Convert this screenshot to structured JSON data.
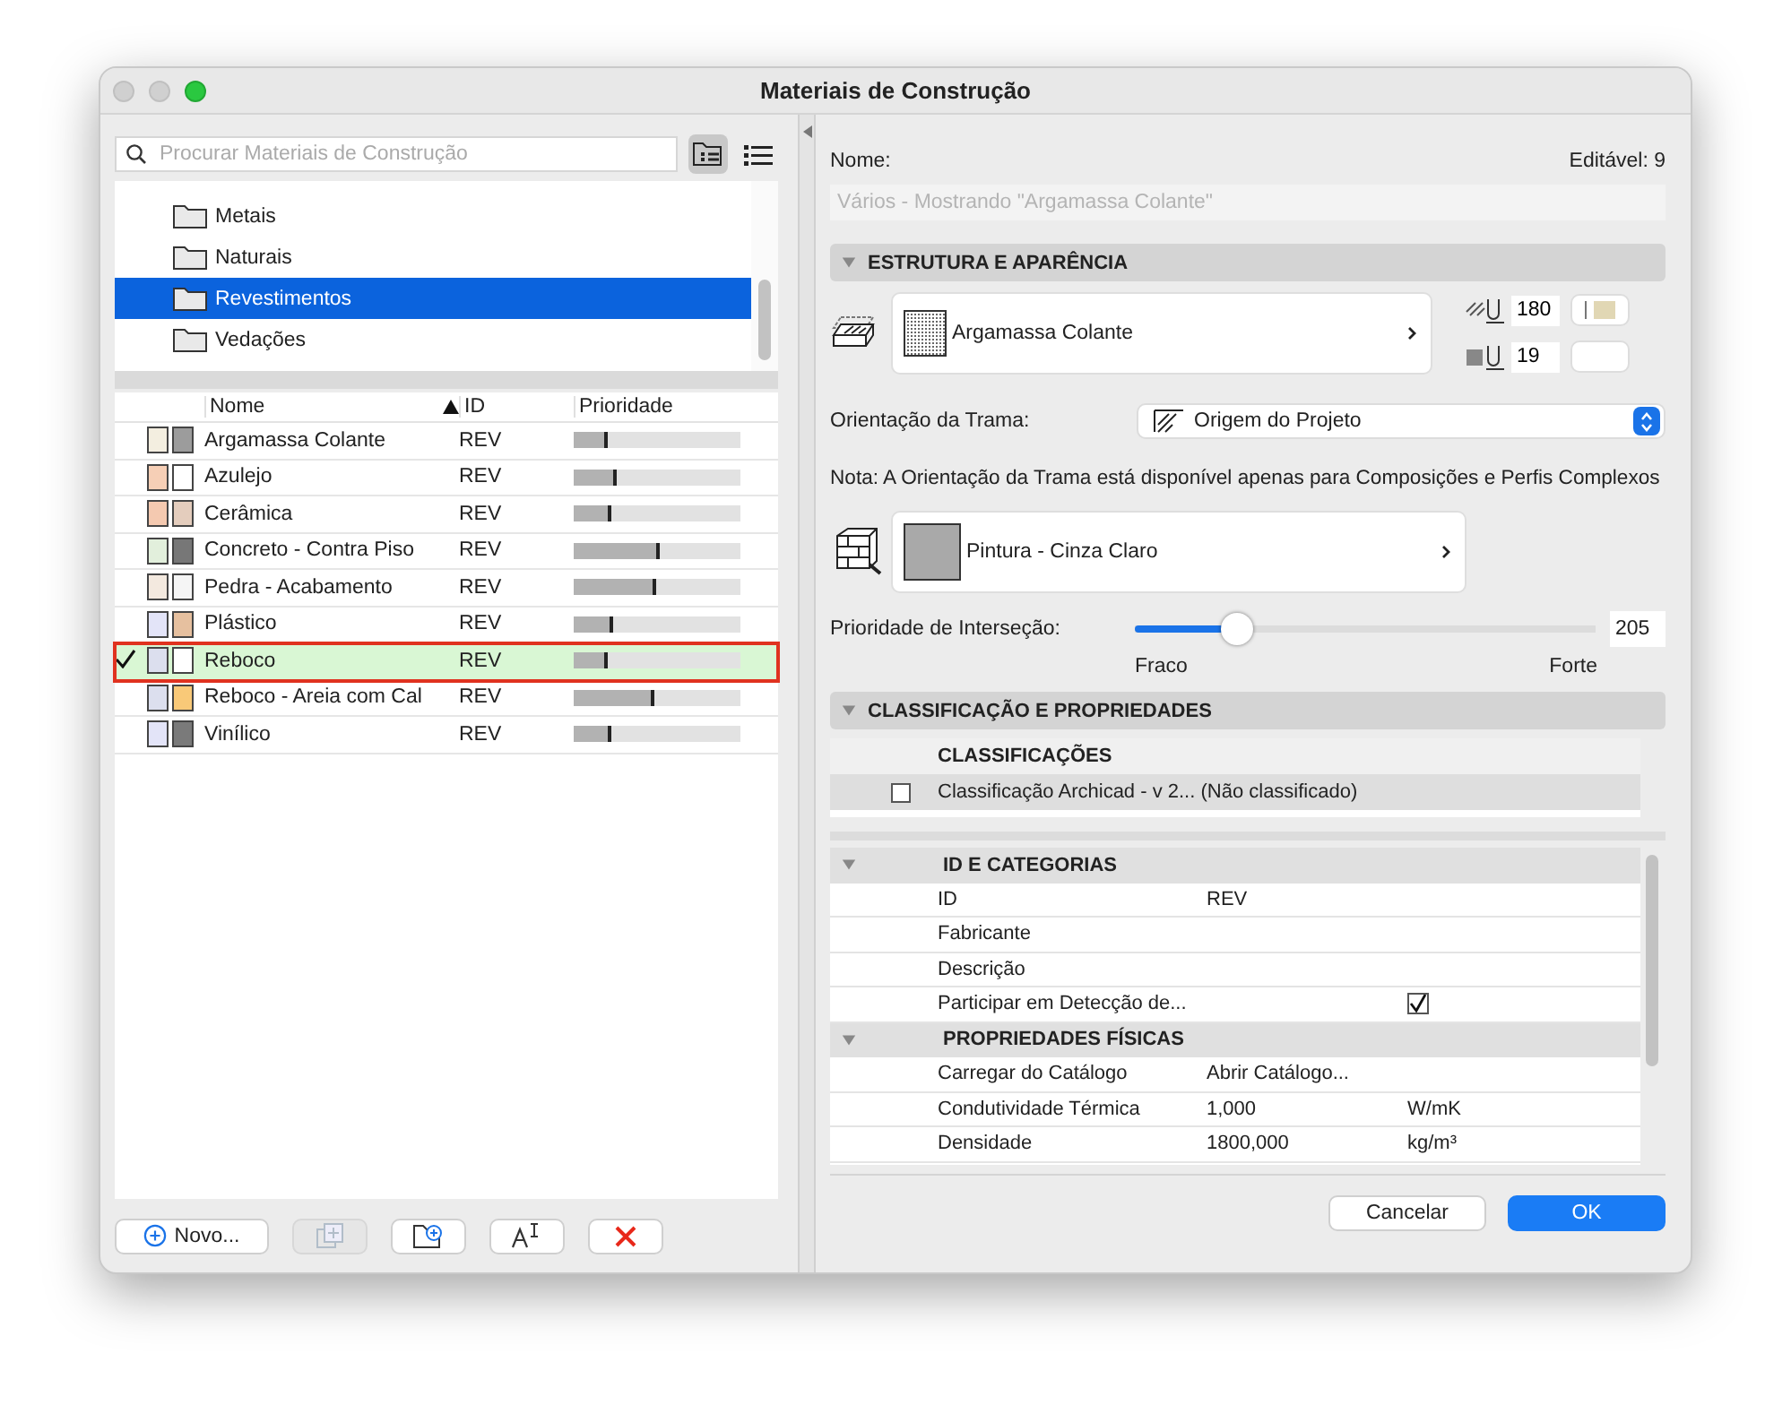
{
  "window": {
    "title": "Materiais de Construção"
  },
  "search": {
    "placeholder": "Procurar Materiais de Construção"
  },
  "view_toggles": [
    {
      "kind": "folders",
      "selected": true
    },
    {
      "kind": "list",
      "selected": false
    }
  ],
  "folders": [
    {
      "label": "Metais",
      "selected": false
    },
    {
      "label": "Naturais",
      "selected": false
    },
    {
      "label": "Revestimentos",
      "selected": true
    },
    {
      "label": "Vedações",
      "selected": false
    }
  ],
  "materials_table": {
    "columns": [
      {
        "label": "Nome",
        "sorted": true
      },
      {
        "label": "ID",
        "sorted": false
      },
      {
        "label": "Prioridade",
        "sorted": false
      }
    ],
    "rows": [
      {
        "name": "Argamassa Colante",
        "id": "REV",
        "level": 0.2,
        "fill_swatch": {
          "color": "#f3eee0"
        },
        "surface_swatch": {
          "color": "#9c9c9c"
        },
        "selected": false
      },
      {
        "name": "Azulejo",
        "id": "REV",
        "level": 0.26,
        "fill_swatch": {
          "color": "#f6cfb6"
        },
        "surface_swatch": {
          "color": "#ffffff"
        },
        "selected": false
      },
      {
        "name": "Cerâmica",
        "id": "REV",
        "level": 0.23,
        "fill_swatch": {
          "color": "#f4c9b0"
        },
        "surface_swatch": {
          "color": "#e4cdbd"
        },
        "selected": false
      },
      {
        "name": "Concreto - Contra Piso",
        "id": "REV",
        "level": 0.52,
        "fill_swatch": {
          "color": "#e2efdc"
        },
        "surface_swatch": {
          "color": "#777777"
        },
        "selected": false
      },
      {
        "name": "Pedra - Acabamento",
        "id": "REV",
        "level": 0.49,
        "fill_swatch": {
          "color": "#f3e9df"
        },
        "surface_swatch": {
          "color": "#f5f5f5"
        },
        "selected": false
      },
      {
        "name": "Plástico",
        "id": "REV",
        "level": 0.24,
        "fill_swatch": {
          "color": "#e3e4f8"
        },
        "surface_swatch": {
          "color": "#e6c09f"
        },
        "selected": false
      },
      {
        "name": "Reboco",
        "id": "REV",
        "level": 0.2,
        "fill_swatch": {
          "color": "#dcdfee"
        },
        "surface_swatch": {
          "color": "#ffffff"
        },
        "selected": true
      },
      {
        "name": "Reboco - Areia com Cal",
        "id": "REV",
        "level": 0.48,
        "fill_swatch": {
          "color": "#dcdfee"
        },
        "surface_swatch": {
          "color": "#f9c978"
        },
        "selected": false
      },
      {
        "name": "Vinílico",
        "id": "REV",
        "level": 0.23,
        "fill_swatch": {
          "color": "#e3e4f8"
        },
        "surface_swatch": {
          "color": "#7a7a7a"
        },
        "selected": false
      }
    ]
  },
  "left_buttons": [
    {
      "kind": "new",
      "label": "Novo...",
      "disabled": false
    },
    {
      "kind": "duplicate",
      "disabled": true
    },
    {
      "kind": "new-folder",
      "disabled": false
    },
    {
      "kind": "rename",
      "disabled": false
    },
    {
      "kind": "delete",
      "disabled": false
    }
  ],
  "name_label": "Nome:",
  "editable_count": "Editável: 9",
  "name_field": {
    "placeholder": "Vários - Mostrando \"Argamassa Colante\""
  },
  "structure_section": {
    "title": "ESTRUTURA E APARÊNCIA",
    "expanded": true,
    "cut_fill": {
      "label": "Argamassa Colante"
    },
    "fill_pen": "180",
    "background_pen": "19",
    "fill_color": {
      "color": "#e1d7b4"
    },
    "orientation_label": "Orientação da Trama:",
    "orientation_value": "Origem do Projeto",
    "note": "Nota: A Orientação da Trama está disponível apenas para Composições e Perfis Complexos",
    "surface": {
      "label": "Pintura - Cinza Claro",
      "color": "#a9a9a9"
    },
    "priority_label": "Prioridade de Interseção:",
    "priority": {
      "level": 0.22
    },
    "priority_value": "205",
    "weak_label": "Fraco",
    "strong_label": "Forte"
  },
  "classification_section": {
    "title": "CLASSIFICAÇÃO E PROPRIEDADES",
    "expanded": true,
    "classifications_header": "CLASSIFICAÇÕES",
    "classifications": [
      {
        "label": "Classificação Archicad - v 2... (Não classificado)",
        "checked": false
      }
    ],
    "property_groups": [
      {
        "title": "ID E CATEGORIAS",
        "expanded": true,
        "rows": [
          {
            "kind": "text",
            "name": "ID",
            "value": "REV"
          },
          {
            "kind": "text",
            "name": "Fabricante"
          },
          {
            "kind": "text",
            "name": "Descrição"
          },
          {
            "kind": "checkbox",
            "name": "Participar em Detecção de...",
            "checked": true
          }
        ]
      },
      {
        "title": "PROPRIEDADES FÍSICAS",
        "expanded": true,
        "rows": [
          {
            "kind": "text",
            "name": "Carregar do Catálogo",
            "value": "Abrir Catálogo..."
          },
          {
            "kind": "text",
            "name": "Condutividade Térmica",
            "value": "1,000",
            "unit": "W/mK"
          },
          {
            "kind": "text",
            "name": "Densidade",
            "value": "1800,000",
            "unit": "kg/m³"
          }
        ]
      }
    ]
  },
  "dialog_buttons": [
    {
      "label": "Cancelar",
      "kind": "cancel"
    },
    {
      "label": "OK",
      "kind": "default"
    }
  ]
}
